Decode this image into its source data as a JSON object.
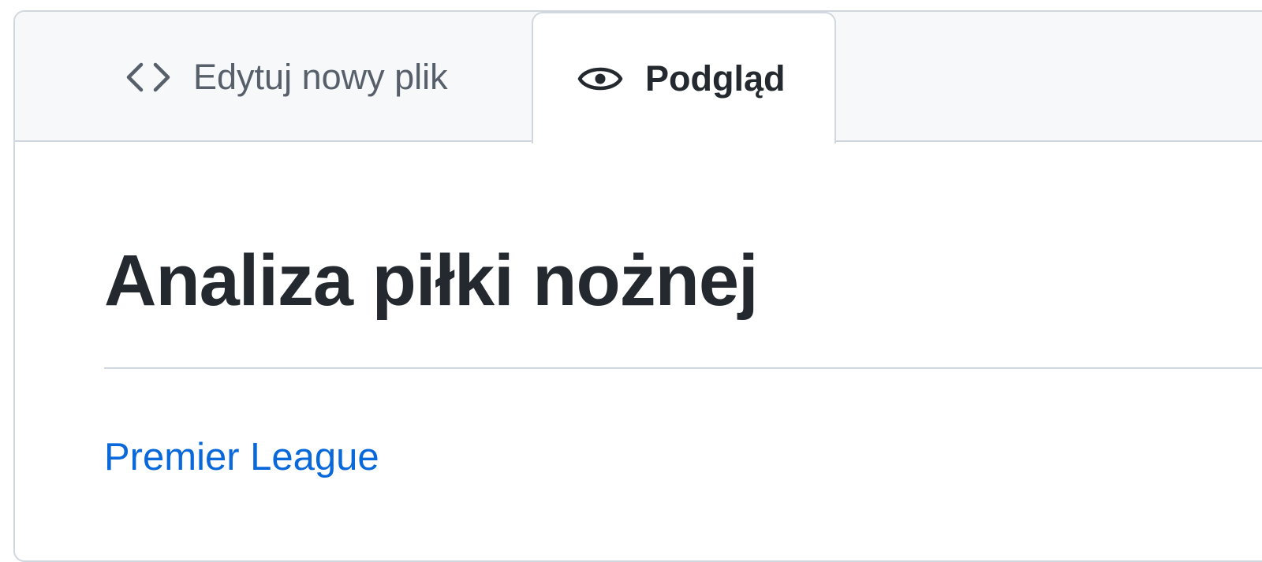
{
  "tabs": {
    "edit": {
      "label": "Edytuj nowy plik",
      "icon": "code-icon",
      "active": false
    },
    "preview": {
      "label": "Podgląd",
      "icon": "eye-icon",
      "active": true
    }
  },
  "document": {
    "title": "Analiza piłki nożnej",
    "link_text": "Premier League"
  },
  "colors": {
    "border": "#d0d7de",
    "tab_bar_bg": "#f6f8fa",
    "text_primary": "#24292f",
    "text_muted": "#57606a",
    "link": "#0969da"
  }
}
